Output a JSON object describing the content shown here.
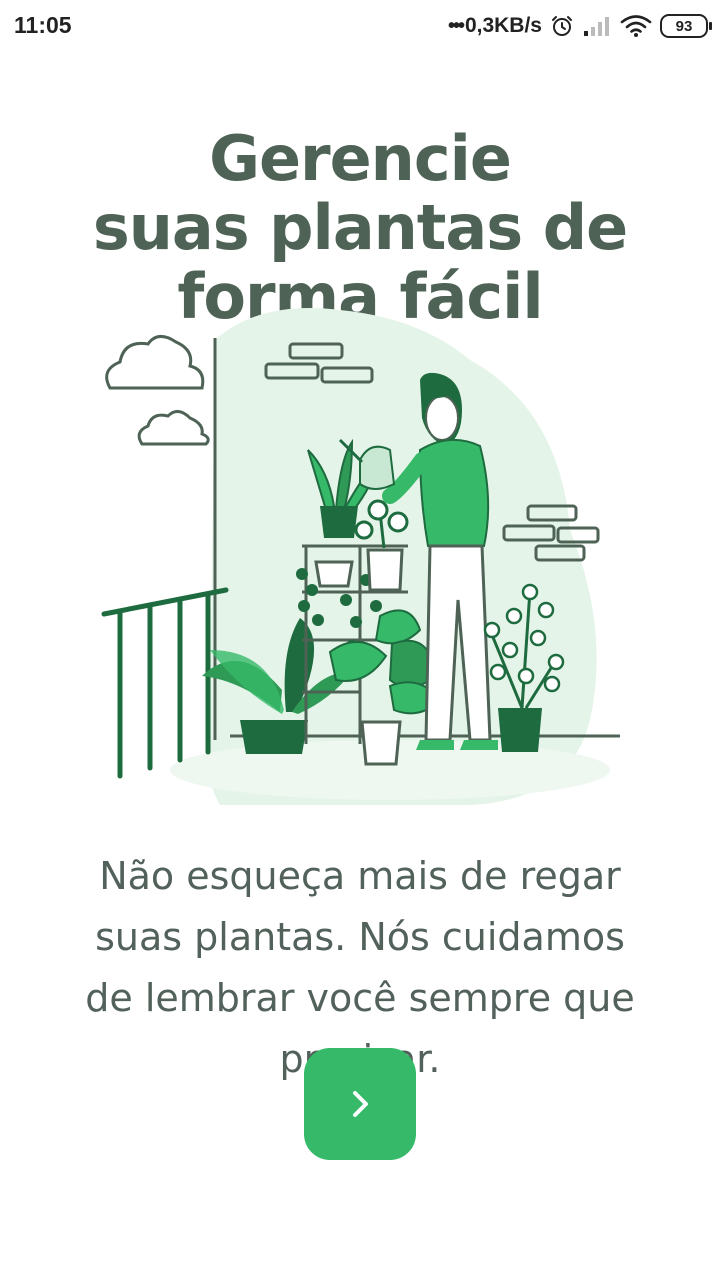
{
  "status_bar": {
    "time": "11:05",
    "dots": "•••",
    "net_speed": "0,3KB/s",
    "battery": "93",
    "icons": [
      "alarm-icon",
      "signal-icon",
      "wifi-icon",
      "battery-icon"
    ]
  },
  "onboarding": {
    "title_lines": [
      "Gerencie",
      "suas plantas de",
      "forma fácil"
    ],
    "description": "Não esqueça mais de regar suas plantas. Nós cuidamos de lembrar você sempre que precisar.",
    "next_button_icon": "chevron-right-icon",
    "illustration": "woman-watering-plants-balcony"
  },
  "colors": {
    "title": "#4e6355",
    "text": "#52615a",
    "accent": "#36b968",
    "plant_dark": "#1e6b3f",
    "plant_mid": "#2f9a56",
    "blob": "#e4f4e8"
  }
}
